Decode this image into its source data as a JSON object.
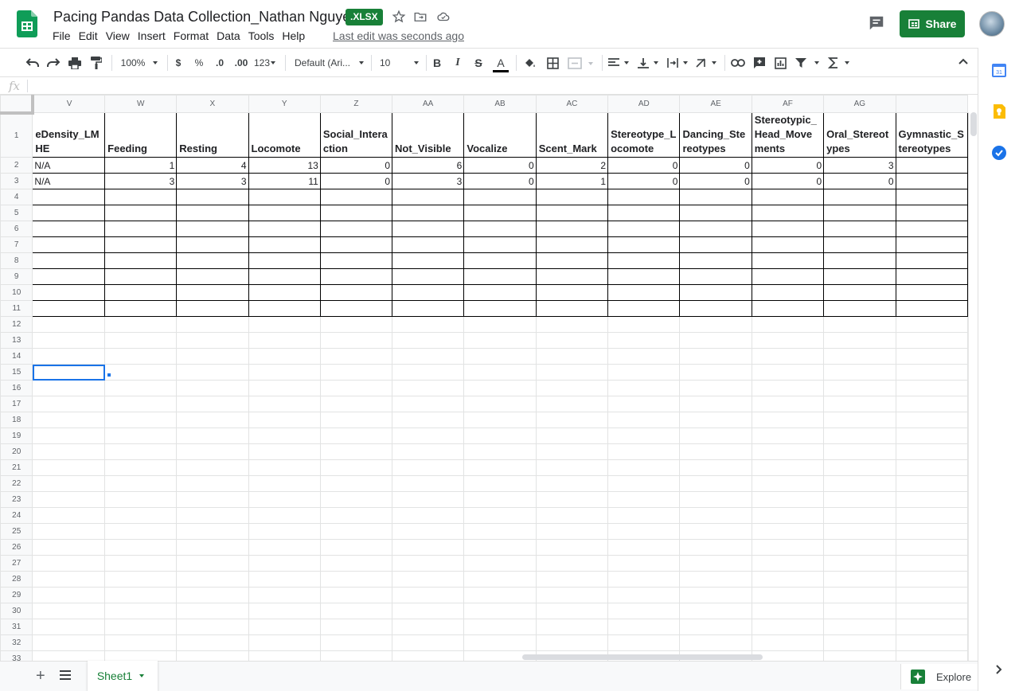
{
  "app": {
    "title": "Pacing Pandas Data Collection_Nathan Nguyen",
    "badge": ".XLSX",
    "last_edit": "Last edit was seconds ago",
    "share_label": "Share"
  },
  "menu": [
    "File",
    "Edit",
    "View",
    "Insert",
    "Format",
    "Data",
    "Tools",
    "Help"
  ],
  "toolbar": {
    "zoom": "100%",
    "currency": "$",
    "percent": "%",
    "decrease_decimal": ".0",
    "increase_decimal": ".00",
    "more_formats": "123",
    "font": "Default (Ari...",
    "font_size": "10",
    "bold": "B",
    "italic": "I",
    "strike": "S",
    "text_color": "A"
  },
  "formula_bar": {
    "fx": "fx"
  },
  "sheet": {
    "columns": [
      "V",
      "W",
      "X",
      "Y",
      "Z",
      "AA",
      "AB",
      "AC",
      "AD",
      "AE",
      "AF",
      "AG",
      ""
    ],
    "header_row": [
      "eDensity_LMHE",
      "Feeding",
      "Resting",
      "Locomote",
      "Social_Interaction",
      "Not_Visible",
      "Vocalize",
      "Scent_Mark",
      "Stereotype_Locomote",
      "Dancing_Stereotypes",
      "Stereotypic_Head_Movements",
      "Oral_Stereotypes",
      "Gymnastic_Stereotypes"
    ],
    "data_rows": [
      [
        "N/A",
        "1",
        "4",
        "13",
        "0",
        "6",
        "0",
        "2",
        "0",
        "0",
        "0",
        "3",
        ""
      ],
      [
        "N/A",
        "3",
        "3",
        "11",
        "0",
        "3",
        "0",
        "1",
        "0",
        "0",
        "0",
        "0",
        ""
      ]
    ],
    "row_numbers": [
      "1",
      "2",
      "3",
      "4",
      "5",
      "6",
      "7",
      "8",
      "9",
      "10",
      "11",
      "12",
      "13",
      "14",
      "15",
      "16",
      "17",
      "18",
      "19",
      "20",
      "21",
      "22",
      "23",
      "24",
      "25",
      "26",
      "27",
      "28",
      "29",
      "30",
      "31",
      "32",
      "33"
    ],
    "selected_row": "15",
    "tab_name": "Sheet1"
  },
  "explore_label": "Explore",
  "colors": {
    "accent": "#188038",
    "selection": "#1a73e8"
  }
}
